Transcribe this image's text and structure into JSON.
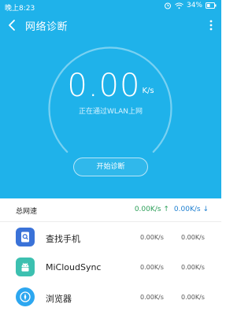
{
  "status_bar": {
    "time": "晚上8:23",
    "battery": "34%",
    "icons": [
      "alarm-icon",
      "wifi-icon",
      "battery-icon"
    ]
  },
  "header": {
    "title": "网络诊断",
    "back_icon": "chevron-left-icon",
    "menu_icon": "more-vertical-icon"
  },
  "speed": {
    "value": "0.00",
    "unit": "K/s",
    "status": "正在通过WLAN上网"
  },
  "start_button": {
    "label": "开始诊断"
  },
  "summary": {
    "label": "总网速",
    "upload": "0.00K/s",
    "download": "0.00K/s"
  },
  "apps": [
    {
      "name": "查找手机",
      "upload": "0.00K/s",
      "download": "0.00K/s",
      "icon": "find-phone-icon",
      "color": "#3a72d8"
    },
    {
      "name": "MiCloudSync",
      "upload": "0.00K/s",
      "download": "0.00K/s",
      "icon": "android-icon",
      "color": "#3cc0b0"
    },
    {
      "name": "浏览器",
      "upload": "0.00K/s",
      "download": "0.00K/s",
      "icon": "browser-icon",
      "color": "#2da7f0"
    }
  ],
  "colors": {
    "accent": "#1fb2ea",
    "upload": "#2ea05a",
    "download": "#1e7fd0"
  }
}
